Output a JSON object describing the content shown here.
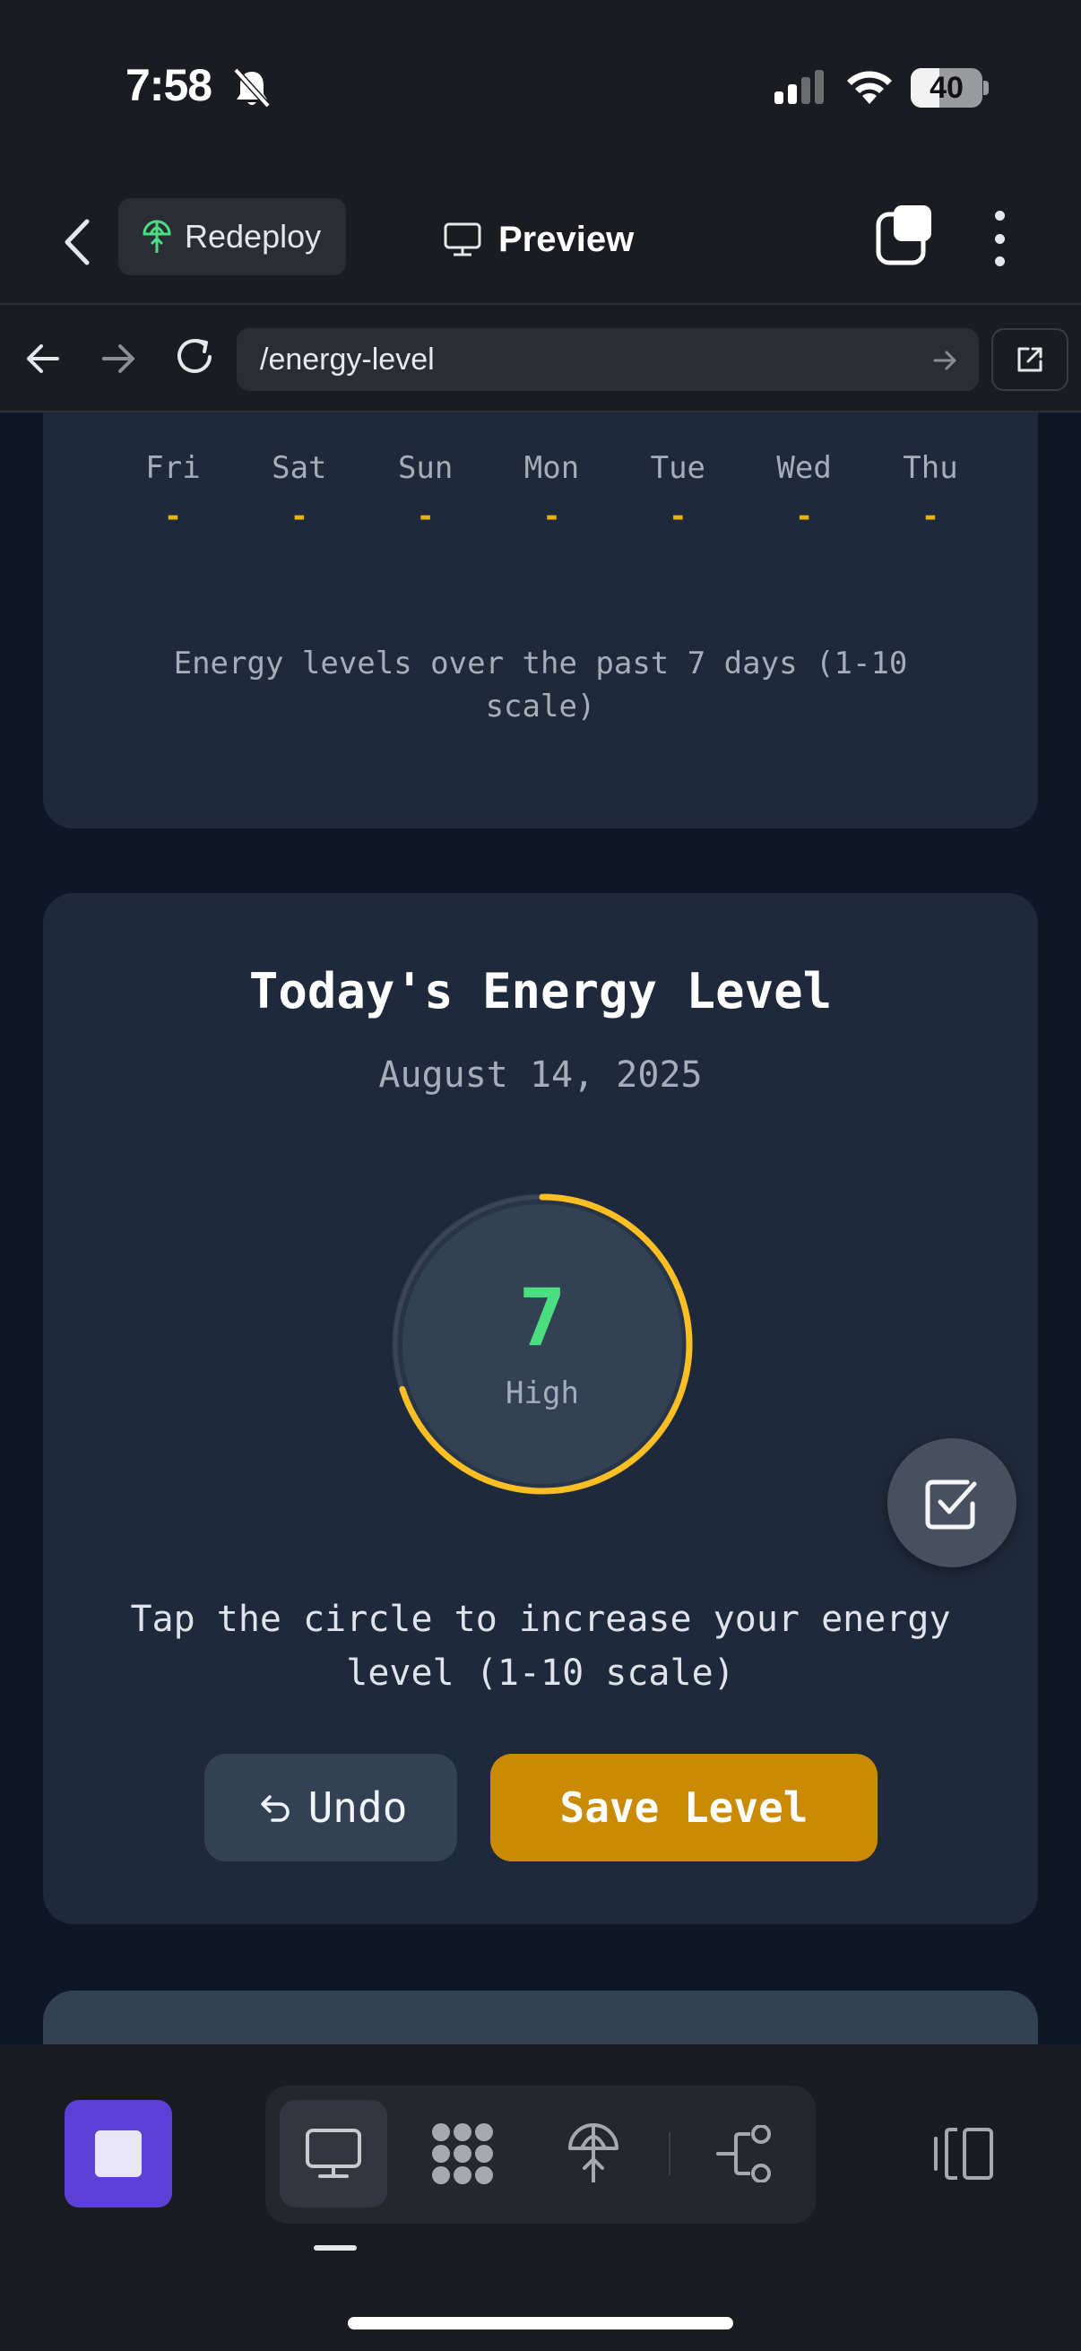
{
  "status_bar": {
    "time": "7:58",
    "battery": "40",
    "battery_level": 0.4
  },
  "header": {
    "redeploy_label": "Redeploy",
    "preview_label": "Preview"
  },
  "browser": {
    "url": "/energy-level"
  },
  "history": {
    "days": [
      {
        "name": "Fri",
        "value": "-"
      },
      {
        "name": "Sat",
        "value": "-"
      },
      {
        "name": "Sun",
        "value": "-"
      },
      {
        "name": "Mon",
        "value": "-"
      },
      {
        "name": "Tue",
        "value": "-"
      },
      {
        "name": "Wed",
        "value": "-"
      },
      {
        "name": "Thu",
        "value": "-"
      }
    ],
    "caption": "Energy levels over the past 7 days (1-10 scale)"
  },
  "today": {
    "title": "Today's Energy Level",
    "date": "August 14, 2025",
    "level": "7",
    "level_max": 10,
    "level_label": "High",
    "instruction": "Tap the circle to increase your energy level (1-10 scale)",
    "undo_label": "Undo",
    "save_label": "Save Level"
  },
  "colors": {
    "accent": "#eab308",
    "level_value": "#4ade80",
    "save_button": "#ca8a04",
    "stop_button": "#5b3fd6"
  }
}
